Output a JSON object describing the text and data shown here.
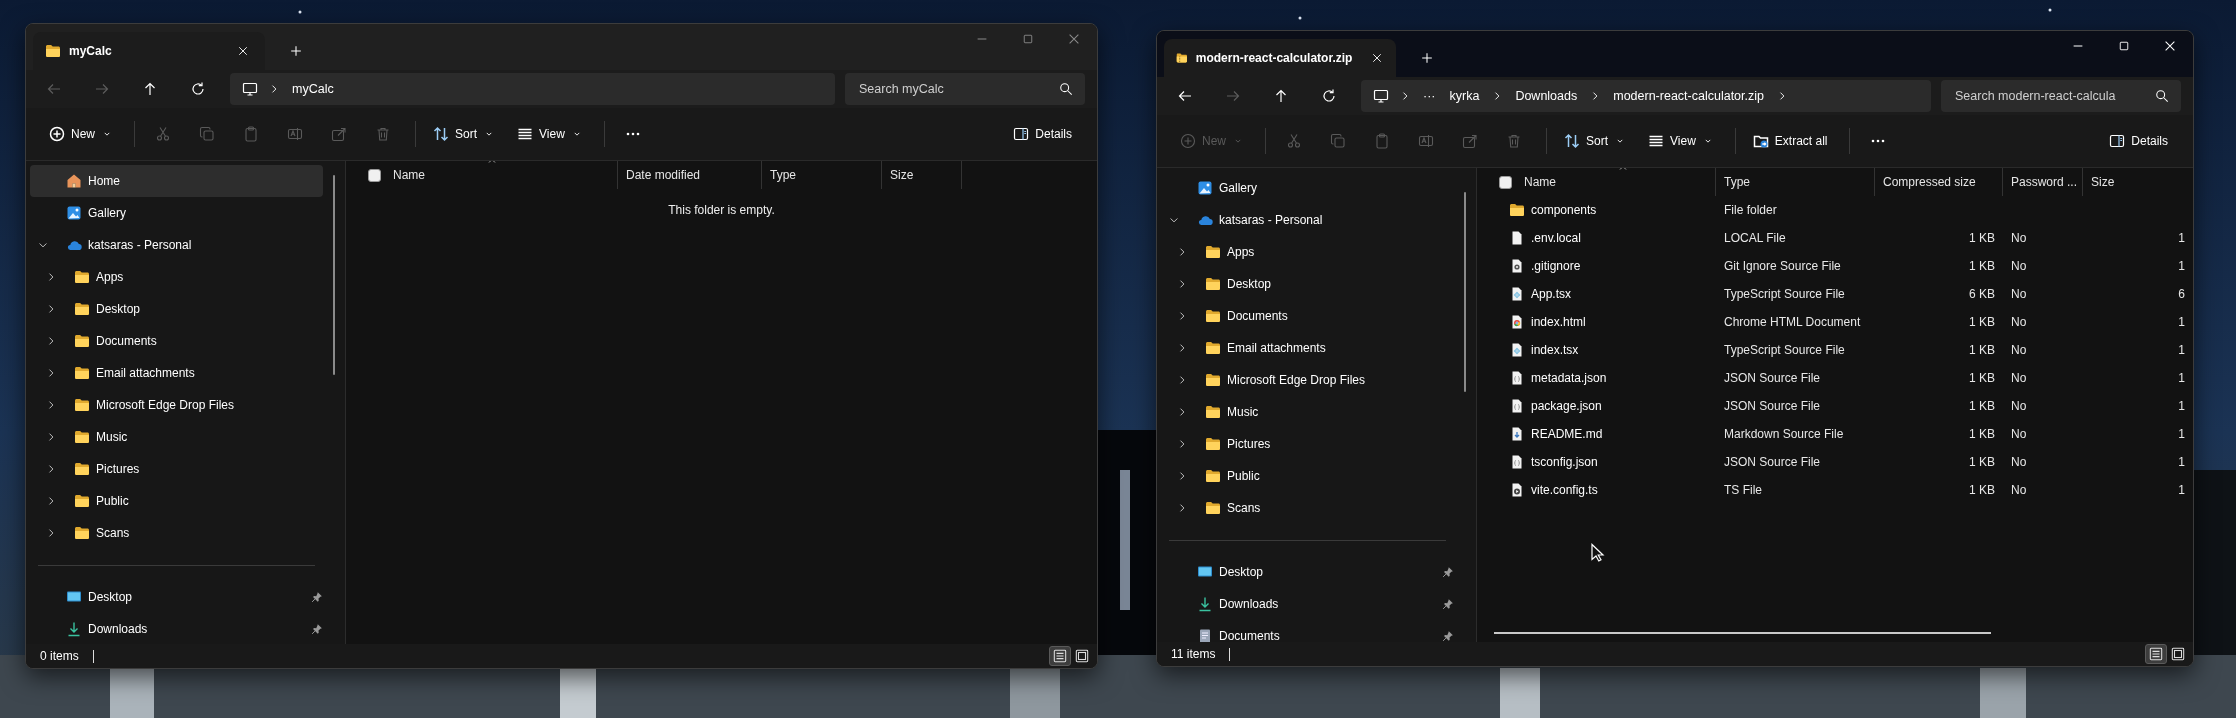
{
  "windows": [
    {
      "active": false,
      "tab": {
        "title": "myCalc",
        "kind": "folder"
      },
      "nav": [
        {
          "kind": "back",
          "disabled": true
        },
        {
          "kind": "forward",
          "disabled": true
        },
        {
          "kind": "up",
          "disabled": false
        },
        {
          "kind": "refresh",
          "disabled": false
        }
      ],
      "breadcrumbs": [
        {
          "kind": "folder",
          "label": "myCalc"
        }
      ],
      "trailing_chevron": false,
      "search": {
        "placeholder": "Search myCalc"
      },
      "toolbar": [
        {
          "kind": "new",
          "label": "New",
          "disabled": false
        },
        {
          "kind": "cut",
          "disabled": true
        },
        {
          "kind": "copy",
          "disabled": true
        },
        {
          "kind": "paste",
          "disabled": true
        },
        {
          "kind": "rename",
          "disabled": true
        },
        {
          "kind": "share",
          "disabled": true
        },
        {
          "kind": "delete",
          "disabled": true
        },
        {
          "kind": "sort",
          "label": "Sort",
          "disabled": false
        },
        {
          "kind": "view",
          "label": "View",
          "disabled": false
        },
        {
          "kind": "more",
          "disabled": false
        }
      ],
      "details_button": "Details",
      "sidebar": {
        "items": [
          {
            "kind": "home",
            "label": "Home",
            "selected": true
          },
          {
            "kind": "gallery",
            "label": "Gallery",
            "selected": false
          },
          {
            "kind": "cloud",
            "label": "katsaras - Personal",
            "selected": false,
            "expanded": true,
            "children": [
              {
                "kind": "folder",
                "label": "Apps",
                "selected": false,
                "expanded": false
              },
              {
                "kind": "folder",
                "label": "Desktop",
                "selected": false,
                "expanded": false
              },
              {
                "kind": "folder",
                "label": "Documents",
                "selected": false,
                "expanded": false
              },
              {
                "kind": "folder",
                "label": "Email attachments",
                "selected": false,
                "expanded": false
              },
              {
                "kind": "folder",
                "label": "Microsoft Edge Drop Files",
                "selected": false,
                "expanded": false
              },
              {
                "kind": "folder",
                "label": "Music",
                "selected": false,
                "expanded": false
              },
              {
                "kind": "folder",
                "label": "Pictures",
                "selected": false,
                "expanded": false
              },
              {
                "kind": "folder",
                "label": "Public",
                "selected": false,
                "expanded": false
              },
              {
                "kind": "folder",
                "label": "Scans",
                "selected": false,
                "expanded": false
              }
            ]
          }
        ],
        "pinned": [
          {
            "kind": "desktop",
            "label": "Desktop",
            "selected": false
          },
          {
            "kind": "downloads",
            "label": "Downloads",
            "selected": false
          }
        ]
      },
      "select_all": {
        "checked": false
      },
      "columns": [
        "Name",
        "Date modified",
        "Type",
        "Size"
      ],
      "empty_message": "This folder is empty.",
      "status": "0 items",
      "view_modes": [
        {
          "kind": "details",
          "selected": true
        },
        {
          "kind": "tiles",
          "selected": false
        }
      ]
    },
    {
      "active": true,
      "tab": {
        "title": "modern-react-calculator.zip",
        "kind": "zip"
      },
      "nav": [
        {
          "kind": "back",
          "disabled": false
        },
        {
          "kind": "forward",
          "disabled": true
        },
        {
          "kind": "up",
          "disabled": false
        },
        {
          "kind": "refresh",
          "disabled": false
        }
      ],
      "breadcrumbs": [
        {
          "kind": "overflow",
          "label": "···"
        },
        {
          "kind": "folder",
          "label": "kyrka"
        },
        {
          "kind": "folder",
          "label": "Downloads"
        },
        {
          "kind": "folder",
          "label": "modern-react-calculator.zip"
        }
      ],
      "trailing_chevron": true,
      "search": {
        "placeholder": "Search modern-react-calcula"
      },
      "toolbar": [
        {
          "kind": "new",
          "label": "New",
          "disabled": true
        },
        {
          "kind": "cut",
          "disabled": true
        },
        {
          "kind": "copy",
          "disabled": true
        },
        {
          "kind": "paste",
          "disabled": true
        },
        {
          "kind": "rename",
          "disabled": true
        },
        {
          "kind": "share",
          "disabled": true
        },
        {
          "kind": "delete",
          "disabled": true
        },
        {
          "kind": "sort",
          "label": "Sort",
          "disabled": false
        },
        {
          "kind": "view",
          "label": "View",
          "disabled": false
        },
        {
          "kind": "extract",
          "label": "Extract all",
          "disabled": false
        },
        {
          "kind": "more",
          "disabled": false
        }
      ],
      "details_button": "Details",
      "sidebar": {
        "items": [
          {
            "kind": "gallery",
            "label": "Gallery",
            "selected": false
          },
          {
            "kind": "cloud",
            "label": "katsaras - Personal",
            "selected": false,
            "expanded": true,
            "children": [
              {
                "kind": "folder",
                "label": "Apps",
                "selected": false,
                "expanded": false
              },
              {
                "kind": "folder",
                "label": "Desktop",
                "selected": false,
                "expanded": false
              },
              {
                "kind": "folder",
                "label": "Documents",
                "selected": false,
                "expanded": false
              },
              {
                "kind": "folder",
                "label": "Email attachments",
                "selected": false,
                "expanded": false
              },
              {
                "kind": "folder",
                "label": "Microsoft Edge Drop Files",
                "selected": false,
                "expanded": false
              },
              {
                "kind": "folder",
                "label": "Music",
                "selected": false,
                "expanded": false
              },
              {
                "kind": "folder",
                "label": "Pictures",
                "selected": false,
                "expanded": false
              },
              {
                "kind": "folder",
                "label": "Public",
                "selected": false,
                "expanded": false
              },
              {
                "kind": "folder",
                "label": "Scans",
                "selected": false,
                "expanded": false
              }
            ]
          }
        ],
        "pinned": [
          {
            "kind": "desktop",
            "label": "Desktop",
            "selected": false
          },
          {
            "kind": "downloads",
            "label": "Downloads",
            "selected": false
          },
          {
            "kind": "documents",
            "label": "Documents",
            "selected": false
          }
        ]
      },
      "select_all": {
        "checked": false
      },
      "columns": [
        "Name",
        "Type",
        "Compressed size",
        "Password ...",
        "Size"
      ],
      "rows": [
        {
          "kind": "folder",
          "selected": false,
          "cells": [
            "components",
            "File folder"
          ]
        },
        {
          "kind": "text",
          "selected": false,
          "cells": [
            ".env.local",
            "LOCAL File",
            "1 KB",
            "No",
            "1"
          ]
        },
        {
          "kind": "config",
          "selected": false,
          "cells": [
            ".gitignore",
            "Git Ignore Source File",
            "1 KB",
            "No",
            "1"
          ]
        },
        {
          "kind": "react",
          "selected": false,
          "cells": [
            "App.tsx",
            "TypeScript Source File",
            "6 KB",
            "No",
            "6"
          ]
        },
        {
          "kind": "web",
          "selected": false,
          "cells": [
            "index.html",
            "Chrome HTML Document",
            "1 KB",
            "No",
            "1"
          ]
        },
        {
          "kind": "react",
          "selected": false,
          "cells": [
            "index.tsx",
            "TypeScript Source File",
            "1 KB",
            "No",
            "1"
          ]
        },
        {
          "kind": "json",
          "selected": false,
          "cells": [
            "metadata.json",
            "JSON Source File",
            "1 KB",
            "No",
            "1"
          ]
        },
        {
          "kind": "json",
          "selected": false,
          "cells": [
            "package.json",
            "JSON Source File",
            "1 KB",
            "No",
            "1"
          ]
        },
        {
          "kind": "markdown",
          "selected": false,
          "cells": [
            "README.md",
            "Markdown Source File",
            "1 KB",
            "No",
            "1"
          ]
        },
        {
          "kind": "json",
          "selected": false,
          "cells": [
            "tsconfig.json",
            "JSON Source File",
            "1 KB",
            "No",
            "1"
          ]
        },
        {
          "kind": "script",
          "selected": false,
          "cells": [
            "vite.config.ts",
            "TS File",
            "1 KB",
            "No",
            "1"
          ]
        }
      ],
      "status": "11 items",
      "view_modes": [
        {
          "kind": "details",
          "selected": true
        },
        {
          "kind": "tiles",
          "selected": false
        }
      ]
    }
  ]
}
